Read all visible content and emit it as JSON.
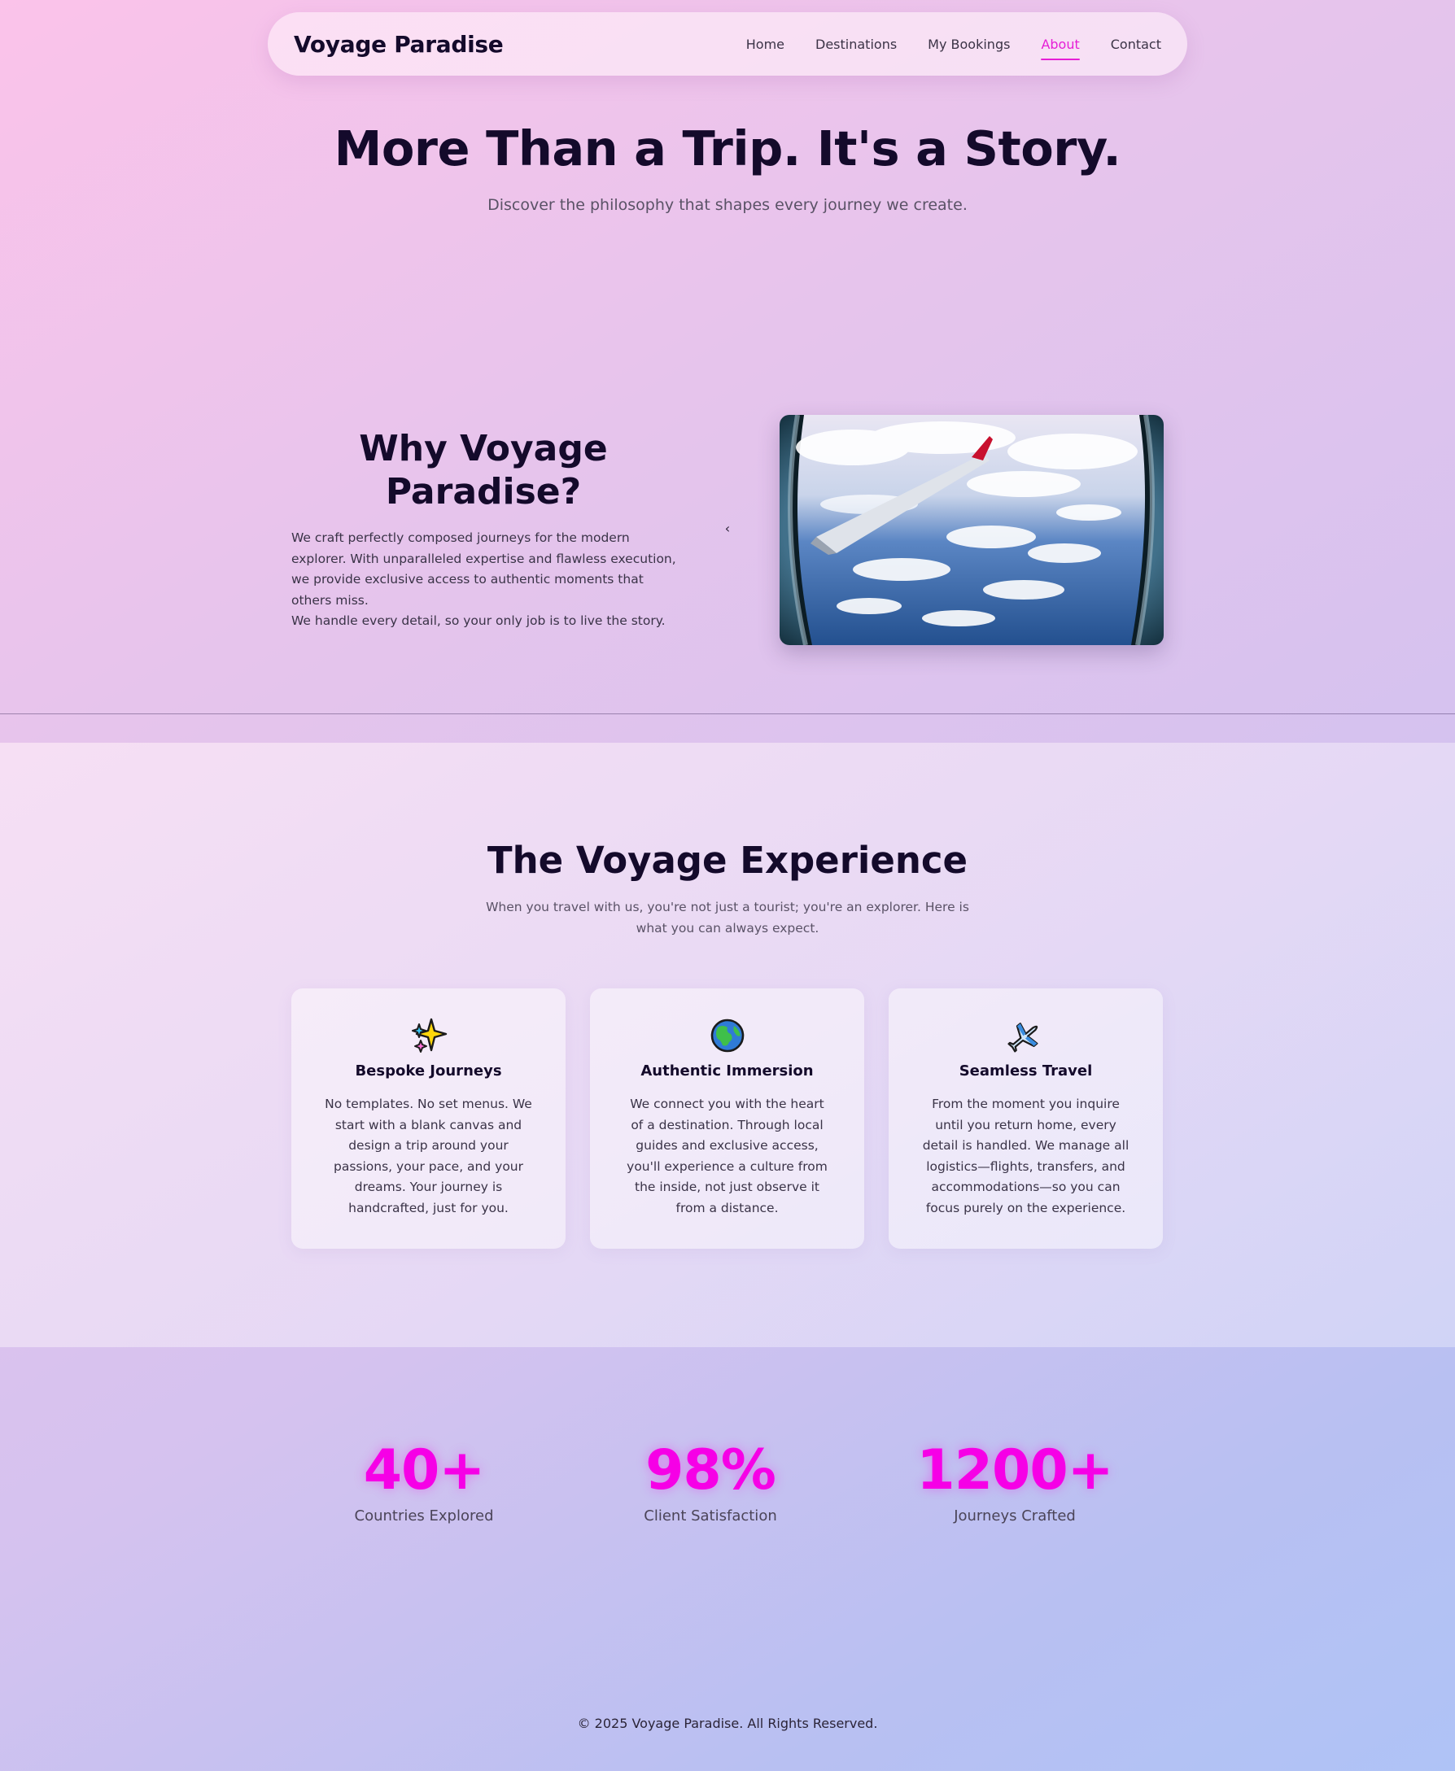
{
  "nav": {
    "brand": "Voyage Paradise",
    "links": [
      {
        "label": "Home",
        "active": false
      },
      {
        "label": "Destinations",
        "active": false
      },
      {
        "label": "My Bookings",
        "active": false
      },
      {
        "label": "About",
        "active": true
      },
      {
        "label": "Contact",
        "active": false
      }
    ]
  },
  "hero": {
    "title": "More Than a Trip. It's a Story.",
    "subtitle": "Discover the philosophy that shapes every journey we create."
  },
  "why": {
    "title": "Why Voyage Paradise?",
    "paragraph1": "We craft perfectly composed journeys for the modern explorer. With unparalleled expertise and flawless execution, we provide exclusive access to authentic moments that others miss.",
    "paragraph2": "We handle every detail, so your only job is to live the story.",
    "prev_icon": "chevron-left-icon",
    "image_icon": "airplane-window-photo"
  },
  "experience": {
    "title": "The Voyage Experience",
    "subtitle": "When you travel with us, you're not just a tourist; you're an explorer. Here is what you can always expect.",
    "cards": [
      {
        "icon": "sparkles-icon",
        "title": "Bespoke Journeys",
        "text": "No templates. No set menus. We start with a blank canvas and design a trip around your passions, your pace, and your dreams. Your journey is handcrafted, just for you."
      },
      {
        "icon": "globe-icon",
        "title": "Authentic Immersion",
        "text": "We connect you with the heart of a destination. Through local guides and exclusive access, you'll experience a culture from the inside, not just observe it from a distance."
      },
      {
        "icon": "airplane-icon",
        "title": "Seamless Travel",
        "text": "From the moment you inquire until you return home, every detail is handled. We manage all logistics—flights, transfers, and accommodations—so you can focus purely on the experience."
      }
    ]
  },
  "stats": [
    {
      "value": "40+",
      "label": "Countries Explored"
    },
    {
      "value": "98%",
      "label": "Client Satisfaction"
    },
    {
      "value": "1200+",
      "label": "Journeys Crafted"
    }
  ],
  "footer": {
    "text": "© 2025 Voyage Paradise. All Rights Reserved."
  },
  "colors": {
    "accent": "#f600e6",
    "nav_active": "#e61fd6",
    "heading": "#140a2b"
  }
}
